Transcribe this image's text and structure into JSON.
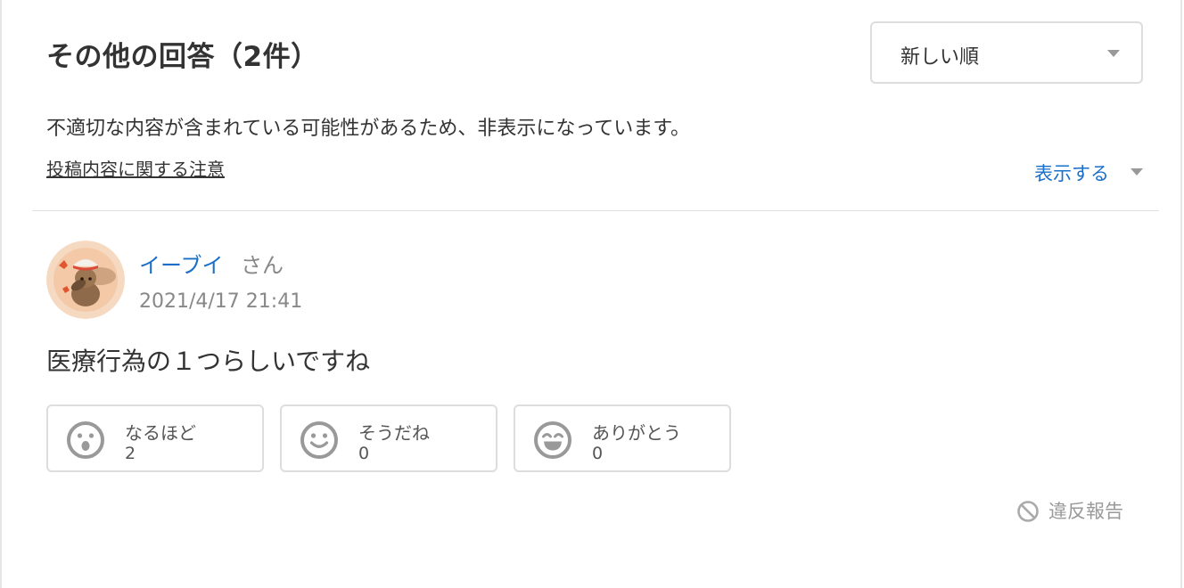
{
  "header": {
    "title": "その他の回答（2件）",
    "sort_selected": "新しい順"
  },
  "notice": {
    "message": "不適切な内容が含まれている可能性があるため、非表示になっています。",
    "guide_link": "投稿内容に関する注意",
    "show_toggle": "表示する"
  },
  "answer": {
    "user_name": "イーブイ",
    "user_suffix": "さん",
    "timestamp": "2021/4/17 21:41",
    "body": "医療行為の１つらしいですね",
    "reactions": [
      {
        "label": "なるほど",
        "count": "2",
        "icon": "surprised-face-icon"
      },
      {
        "label": "そうだね",
        "count": "0",
        "icon": "smile-face-icon"
      },
      {
        "label": "ありがとう",
        "count": "0",
        "icon": "grin-face-icon"
      }
    ],
    "report_label": "違反報告"
  },
  "colors": {
    "link": "#1a6fc9",
    "muted": "#888888",
    "icon_gray": "#999999",
    "border": "#dddddd"
  }
}
